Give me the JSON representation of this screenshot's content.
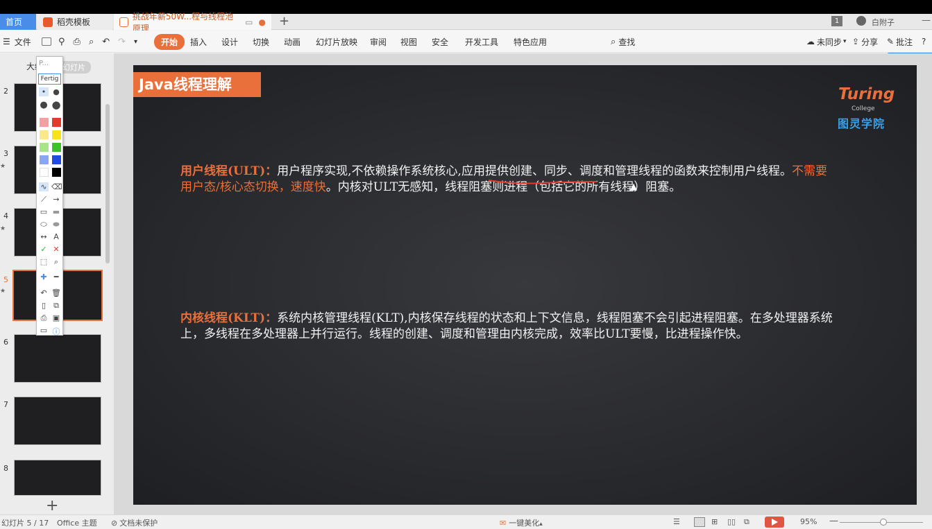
{
  "tabs": {
    "home": "首页",
    "template": "稻壳模板",
    "document": "挑战年薪50W...程与线程池原理"
  },
  "user": {
    "badge": "1",
    "name": "白附子"
  },
  "ribbon": {
    "file": "文件",
    "menu": [
      "开始",
      "插入",
      "设计",
      "切换",
      "动画",
      "幻灯片放映",
      "审阅",
      "视图",
      "安全",
      "开发工具",
      "特色应用"
    ],
    "search": "查找",
    "sync": "未同步",
    "share": "分享",
    "comment": "批注"
  },
  "left_panel": {
    "outline_tab": "大纲",
    "slides_tab": "幻灯片",
    "slide_numbers": [
      "2",
      "3",
      "4",
      "5",
      "6",
      "7",
      "8"
    ]
  },
  "pen_toolbar": {
    "header": "P...",
    "font_label": "Fertig"
  },
  "slide": {
    "title": "Java线程理解",
    "logo_brand": "Turing",
    "logo_college": "College",
    "logo_cn": "图灵学院",
    "ult": {
      "label": "用户线程(ULT)：",
      "text1": "用户程序实现,不依赖操作系统核心,",
      "text2": "应用提供创建、同步、调度和管理线程的函数来控制用户线程。",
      "highlight": "不需要用户态/核心态切换，速度快",
      "text3": "。内核对ULT无感知，线程阻塞则进程（包括它的所有线程）阻塞。"
    },
    "klt": {
      "label": "内核线程(KLT)：",
      "text": "系统内核管理线程(KLT),内核保存线程的状态和上下文信息，线程阻塞不会引起进程阻塞。在多处理器系统上，多线程在多处理器上并行运行。线程的创建、调度和管理由内核完成，效率比ULT要慢，比进程操作快。"
    }
  },
  "status": {
    "slide_info": "幻灯片 5 / 17",
    "theme": "Office 主题",
    "protect": "文档未保护",
    "beautify": "一键美化",
    "zoom": "95%"
  }
}
